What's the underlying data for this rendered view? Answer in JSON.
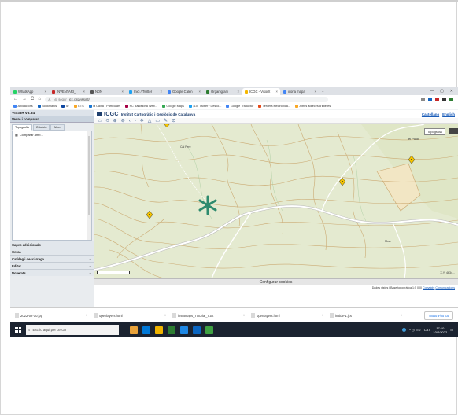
{
  "browser": {
    "tabs": [
      {
        "label": "WhatsApp",
        "color": "#25d366",
        "active": false
      },
      {
        "label": "INVENTARI_",
        "color": "#c62828",
        "active": false
      },
      {
        "label": "NDN",
        "color": "#555555",
        "active": false
      },
      {
        "label": "Inici / Twitter",
        "color": "#1da1f2",
        "active": false
      },
      {
        "label": "Google Calen",
        "color": "#4285f4",
        "active": false
      },
      {
        "label": "Organigram",
        "color": "#2e7d32",
        "active": false
      },
      {
        "label": "ICGC - VisorX",
        "color": "#f5b700",
        "active": true
      },
      {
        "label": "icona mapa",
        "color": "#4285f4",
        "active": false
      }
    ],
    "window_controls": [
      "—",
      "▢",
      "✕"
    ],
    "nav": {
      "back": "←",
      "forward": "→",
      "reload": "C",
      "home": "⌂"
    },
    "url": {
      "not_secure": "No segur",
      "address": "icc.cat/vissir3/"
    },
    "bookmarks": [
      {
        "label": "Aplicacions",
        "color": "#4285f4"
      },
      {
        "label": "Bookmarks",
        "color": "#1565c0"
      },
      {
        "label": "IU",
        "color": "#0d47a1"
      },
      {
        "label": "CTS",
        "color": "#f9a825"
      },
      {
        "label": "la Caixa - Particulars",
        "color": "#1976d2"
      },
      {
        "label": "FC Barcelona Web...",
        "color": "#a50044"
      },
      {
        "label": "Google Maps",
        "color": "#34a853"
      },
      {
        "label": "(10) Twitter / Desco...",
        "color": "#1da1f2"
      },
      {
        "label": "Google Traductor",
        "color": "#4285f4"
      },
      {
        "label": "Tercera electrònica...",
        "color": "#e64a19"
      },
      {
        "label": "Altres adreces d'interès",
        "color": "#f9a825"
      }
    ]
  },
  "app": {
    "sidebar": {
      "title": "VISSIR v3.34",
      "section": "Veure i comparar",
      "tabs": [
        {
          "label": "Topografia",
          "active": true
        },
        {
          "label": "Ortofoto",
          "active": false
        },
        {
          "label": "Altres",
          "active": false
        }
      ],
      "list_item": "Comparar amb...",
      "bottom_items": [
        "Capes addicionals",
        "Cerca",
        "Catàleg i descàrrega",
        "Editar",
        "Novetats"
      ],
      "plus": "+"
    },
    "header": {
      "logo": "ICGC",
      "institute": "Institut Cartogràfic i Geològic de Catalunya",
      "langs": [
        "Castellano",
        "English"
      ]
    },
    "tools": [
      "⌂",
      "⟲",
      "⊕",
      "⊖",
      "‹",
      "›",
      "✥",
      "△",
      "▭",
      "✎",
      "⊙"
    ],
    "map": {
      "basemap_button": "Topografia",
      "coords": "X,Y: 4634...",
      "contour_color": "#c9a46a",
      "road_color": "#ffffff",
      "marker_color": "#f5c400",
      "cross_color": "#2e8b6e",
      "labels": [
        "el Pujol",
        "Mas",
        "Cal Pere"
      ]
    },
    "cookie_bar": "Configurar cookies",
    "attribution": {
      "text": "Dades vistes i Base topogràfica 1:5 000 ",
      "link1": "Copyright",
      "link2": "Comunicacions"
    }
  },
  "downloads": {
    "items": [
      {
        "label": "2022-02-10.jpg"
      },
      {
        "label": "openlayers.html"
      },
      {
        "label": "instamaps_Tutorial_T.txt"
      },
      {
        "label": "openlayers.html"
      },
      {
        "label": "inside-1.jcs"
      }
    ],
    "show_all": "Mostra-ho tot",
    "caret": "^"
  },
  "taskbar": {
    "search_placeholder": "Escriu aquí per cercar",
    "apps": [
      "#e8a23a",
      "#0078d7",
      "#f0b400",
      "#2d7d32",
      "#1e88e5",
      "#0a66c2",
      "#3fa142"
    ],
    "lang": "CAT",
    "time": "17:10",
    "date": "10/2/2022"
  }
}
